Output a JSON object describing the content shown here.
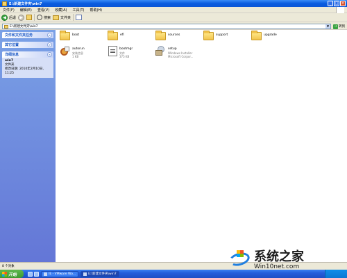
{
  "window": {
    "title": "E:\\新建文件夹\\win7",
    "controls": {
      "minimize": "_",
      "maximize": "□",
      "close": "×"
    }
  },
  "menubar": {
    "items": [
      "文件(F)",
      "编辑(E)",
      "查看(V)",
      "收藏(A)",
      "工具(T)",
      "帮助(H)"
    ]
  },
  "toolbar": {
    "back_label": "后退",
    "forward_label": "",
    "search_label": "搜索",
    "folders_label": "文件夹",
    "back_glyph": "◀",
    "forward_glyph": "▶"
  },
  "address": {
    "label": "",
    "value": "E:\\新建文件夹\\win7",
    "go_label": "转到",
    "go_glyph": "→",
    "dropdown_glyph": "▼"
  },
  "sidebar": {
    "panels": [
      {
        "title": "文件和文件夹任务",
        "toggle": "»"
      },
      {
        "title": "其它位置",
        "toggle": "»"
      },
      {
        "title": "详细信息",
        "toggle": "«"
      }
    ],
    "details": {
      "name": "win7",
      "type": "文件夹",
      "modified": "修改日期: 2010年2月10日, 11:25"
    }
  },
  "files": [
    {
      "name": "boot",
      "kind": "folder",
      "icon": "folder-icon"
    },
    {
      "name": "efi",
      "kind": "folder",
      "icon": "folder-icon"
    },
    {
      "name": "sources",
      "kind": "folder",
      "icon": "folder-icon"
    },
    {
      "name": "support",
      "kind": "folder",
      "icon": "folder-icon"
    },
    {
      "name": "upgrade",
      "kind": "folder",
      "icon": "folder-icon"
    },
    {
      "name": "autorun",
      "kind": "file",
      "icon": "setup-info-icon",
      "sub1": "安装信息",
      "sub2": "1 KB"
    },
    {
      "name": "bootmgr",
      "kind": "file",
      "icon": "system-file-icon",
      "sub1": "文件",
      "sub2": "375 KB"
    },
    {
      "name": "setup",
      "kind": "file",
      "icon": "installer-icon",
      "sub1": "Windows Installer",
      "sub2": "Microsoft Corpor..."
    }
  ],
  "statusbar": {
    "text": "8 个对象"
  },
  "taskbar": {
    "start_label": "开始",
    "tasks": [
      {
        "label": "IE - VMware Wo...",
        "active": false
      },
      {
        "label": "E:\\新建文件夹\\win7",
        "active": true
      }
    ]
  },
  "watermark": {
    "title": "系统之家",
    "url": "Win10net.com"
  },
  "colors": {
    "titlebar": "#0a5ce0",
    "sidebar": "#6375d6",
    "folder": "#f2c44d",
    "taskbar": "#245edb",
    "start": "#3c9a2f"
  }
}
